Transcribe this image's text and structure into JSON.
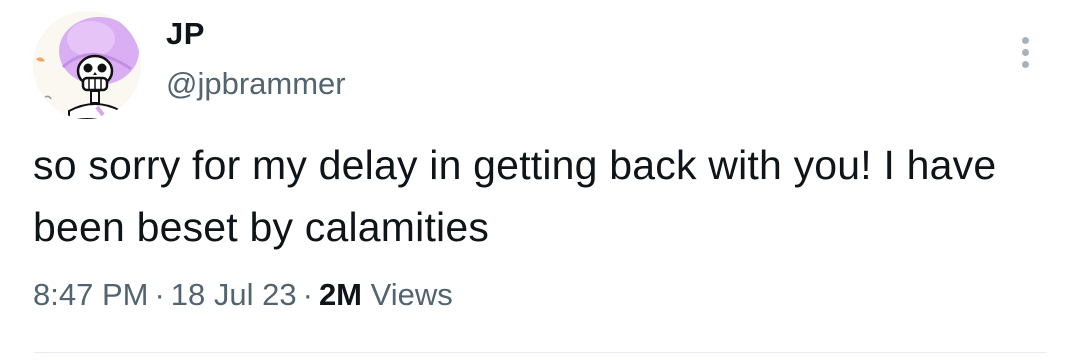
{
  "author": {
    "display_name": "JP",
    "handle": "@jpbrammer",
    "avatar_icon": "skeleton-with-pink-sombrero-icon"
  },
  "tweet": {
    "text": "so sorry for my delay in getting back with you! I have been beset by calamities",
    "time": "8:47 PM",
    "date": "18 Jul 23",
    "views_count": "2M",
    "views_label": "Views",
    "separator": "·"
  },
  "menu": {
    "icon": "more-options-icon"
  },
  "colors": {
    "text_primary": "#0f1419",
    "text_secondary": "#536471",
    "sombrero": "#d6a6f0"
  }
}
